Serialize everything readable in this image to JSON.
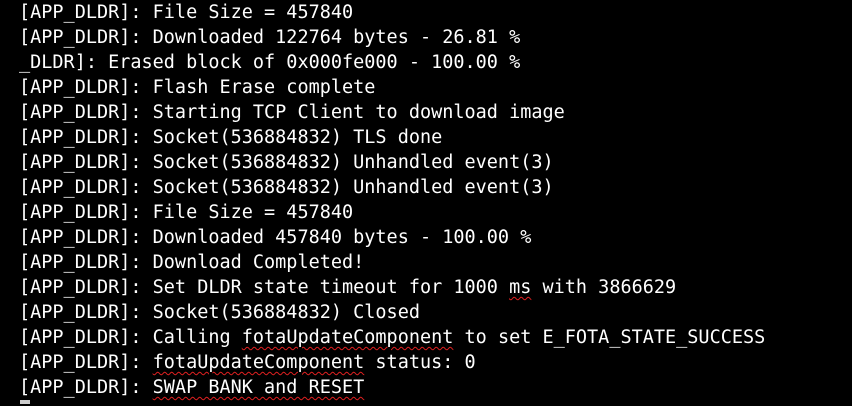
{
  "terminal": {
    "colors": {
      "background": "#000000",
      "text": "#ffffff",
      "spellcheck": "#e02020"
    },
    "lines": [
      {
        "segments": [
          {
            "text": "[APP_DLDR]: File Size = 457840"
          }
        ]
      },
      {
        "segments": [
          {
            "text": "[APP_DLDR]: Downloaded 122764 bytes - 26.81 %"
          }
        ]
      },
      {
        "segments": [
          {
            "text": "_DLDR]: Erased block of 0x000fe000 - 100.00 %"
          }
        ]
      },
      {
        "segments": [
          {
            "text": "[APP_DLDR]: Flash Erase complete"
          }
        ]
      },
      {
        "segments": [
          {
            "text": "[APP_DLDR]: Starting TCP Client to download image"
          }
        ]
      },
      {
        "segments": [
          {
            "text": "[APP_DLDR]: Socket(536884832) TLS done"
          }
        ]
      },
      {
        "segments": [
          {
            "text": "[APP_DLDR]: Socket(536884832) Unhandled event(3)"
          }
        ]
      },
      {
        "segments": [
          {
            "text": "[APP_DLDR]: Socket(536884832) Unhandled event(3)"
          }
        ]
      },
      {
        "segments": [
          {
            "text": "[APP_DLDR]: File Size = 457840"
          }
        ]
      },
      {
        "segments": [
          {
            "text": "[APP_DLDR]: Downloaded 457840 bytes - 100.00 %"
          }
        ]
      },
      {
        "segments": [
          {
            "text": "[APP_DLDR]: Download Completed!"
          }
        ]
      },
      {
        "segments": [
          {
            "text": "[APP_DLDR]: Set DLDR state timeout for 1000 "
          },
          {
            "text": "ms",
            "squiggle": true
          },
          {
            "text": " with 3866629"
          }
        ]
      },
      {
        "segments": [
          {
            "text": "[APP_DLDR]: Socket(536884832) Closed"
          }
        ]
      },
      {
        "segments": [
          {
            "text": "[APP_DLDR]: Calling "
          },
          {
            "text": "fotaUpdateComponent",
            "squiggle": true
          },
          {
            "text": " to set E_FOTA_STATE_SUCCESS"
          }
        ]
      },
      {
        "segments": [
          {
            "text": "[APP_DLDR]: "
          },
          {
            "text": "fotaUpdateComponent",
            "squiggle": true
          },
          {
            "text": " status: 0"
          }
        ]
      },
      {
        "segments": [
          {
            "text": "[APP_DLDR]: "
          },
          {
            "text": "SWAP BANK and RESET",
            "squiggle": true
          }
        ]
      }
    ]
  }
}
